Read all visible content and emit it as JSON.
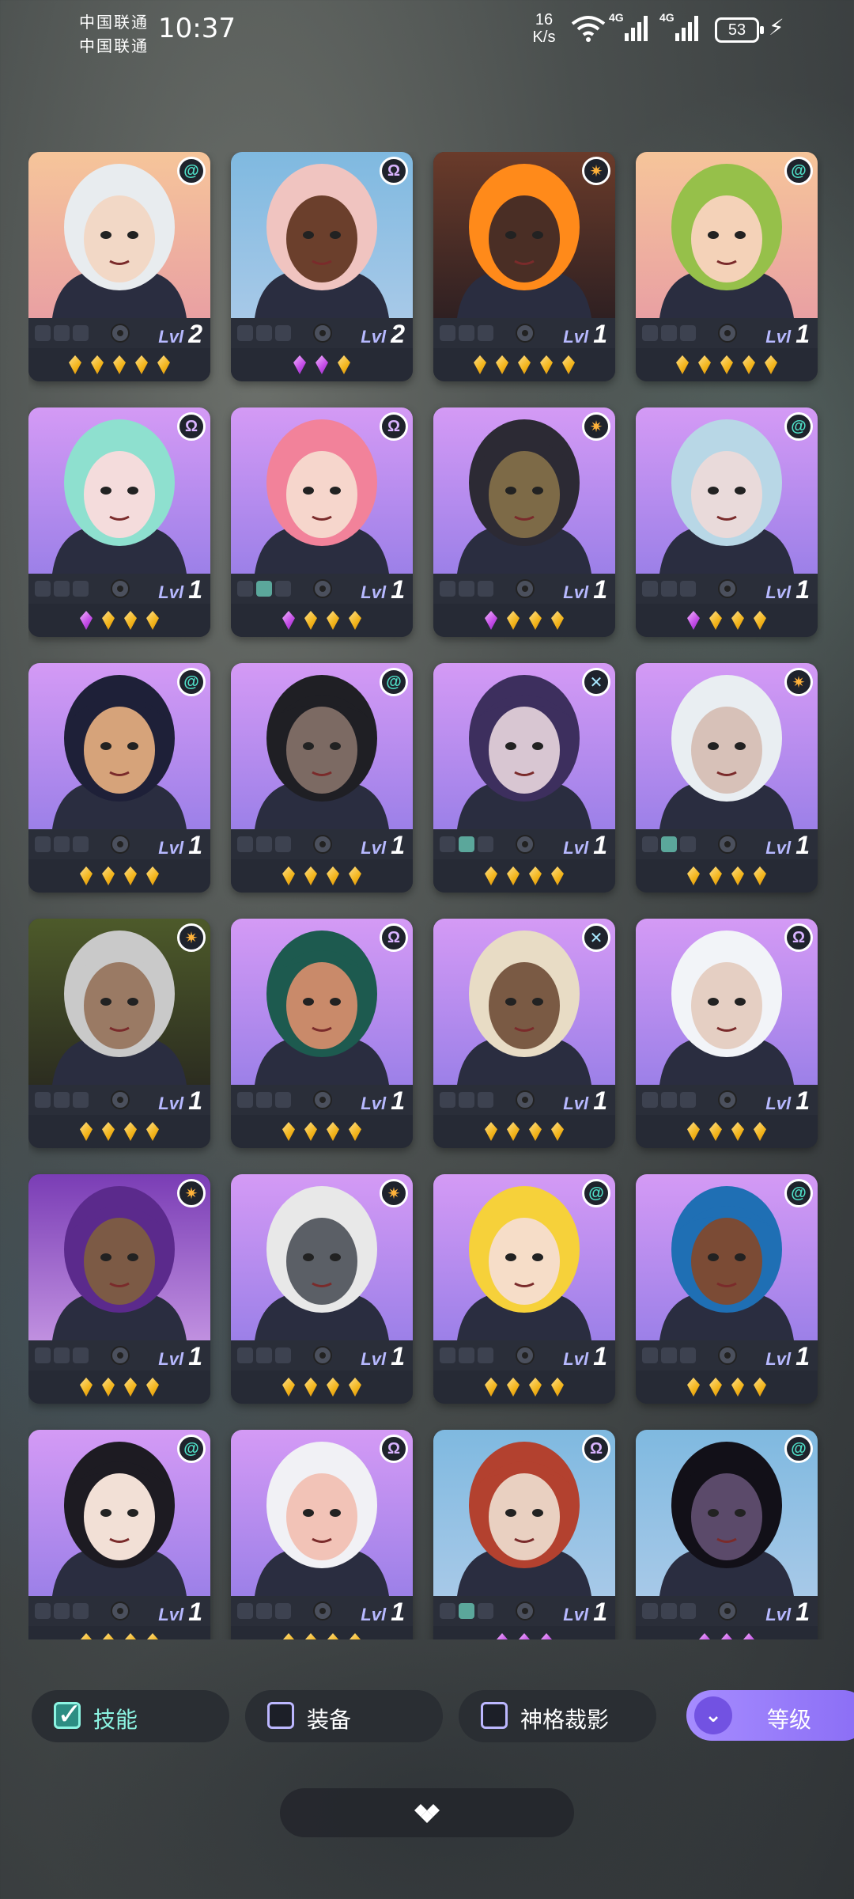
{
  "status_bar": {
    "carrier_1": "中国联通",
    "carrier_2": "中国联通",
    "time": "10:37",
    "net_speed_value": "16",
    "net_speed_unit": "K/s",
    "signal_1": "4G",
    "signal_2": "4G",
    "battery": "53"
  },
  "colors": {
    "portrait_bg_purple": "#c58cf0",
    "portrait_bg_warm": "#f2a56a",
    "accent_teal": "#8cf4e2",
    "accent_purple": "#9c7ff7",
    "gem_gold": "#f2b41b",
    "gem_purple": "#c24be6"
  },
  "class_icons": {
    "spiral": "@",
    "mind": "Ω",
    "sun": "✷",
    "cross": "✕"
  },
  "level_prefix": "Lvl",
  "heroes": [
    {
      "class_icon": "spiral-icon",
      "glyph": "@",
      "level": "2",
      "gems": [
        "gold",
        "gold",
        "gold",
        "gold",
        "gold"
      ],
      "slots_on": [],
      "bg": "warm",
      "hair": "#e8ecef",
      "skin": "#f2d8c6"
    },
    {
      "class_icon": "mind-icon",
      "glyph": "Ω",
      "level": "2",
      "gems": [
        "purple",
        "purple",
        "gold"
      ],
      "slots_on": [],
      "bg": "sky",
      "hair": "#f0c4c0",
      "skin": "#6b3f2c"
    },
    {
      "class_icon": "sun-icon",
      "glyph": "✷",
      "level": "1",
      "gems": [
        "gold",
        "gold",
        "gold",
        "gold",
        "gold"
      ],
      "slots_on": [],
      "bg": "fire",
      "hair": "#ff8a1a",
      "skin": "#4a2e25"
    },
    {
      "class_icon": "spiral-icon",
      "glyph": "@",
      "level": "1",
      "gems": [
        "gold",
        "gold",
        "gold",
        "gold",
        "gold"
      ],
      "slots_on": [],
      "bg": "warm",
      "hair": "#96c04a",
      "skin": "#f4d2b8"
    },
    {
      "class_icon": "mind-icon",
      "glyph": "Ω",
      "level": "1",
      "gems": [
        "purple",
        "gold",
        "gold",
        "gold"
      ],
      "slots_on": [],
      "bg": "purple",
      "hair": "#8ee0cf",
      "skin": "#f4dcdc"
    },
    {
      "class_icon": "mind-icon",
      "glyph": "Ω",
      "level": "1",
      "gems": [
        "purple",
        "gold",
        "gold",
        "gold"
      ],
      "slots_on": [
        1
      ],
      "bg": "purple",
      "hair": "#f2829a",
      "skin": "#f6d6cc"
    },
    {
      "class_icon": "sun-icon",
      "glyph": "✷",
      "level": "1",
      "gems": [
        "purple",
        "gold",
        "gold",
        "gold"
      ],
      "slots_on": [],
      "bg": "purple",
      "hair": "#2c2a34",
      "skin": "#7d6a47"
    },
    {
      "class_icon": "spiral-icon",
      "glyph": "@",
      "level": "1",
      "gems": [
        "purple",
        "gold",
        "gold",
        "gold"
      ],
      "slots_on": [],
      "bg": "purple",
      "hair": "#b8d7e6",
      "skin": "#e9dada"
    },
    {
      "class_icon": "spiral-icon",
      "glyph": "@",
      "level": "1",
      "gems": [
        "gold",
        "gold",
        "gold",
        "gold"
      ],
      "slots_on": [],
      "bg": "purple",
      "hair": "#1e2038",
      "skin": "#d6a37a"
    },
    {
      "class_icon": "spiral-icon",
      "glyph": "@",
      "level": "1",
      "gems": [
        "gold",
        "gold",
        "gold",
        "gold"
      ],
      "slots_on": [],
      "bg": "purple",
      "hair": "#1f1f24",
      "skin": "#7c6a63"
    },
    {
      "class_icon": "cross-icon",
      "glyph": "✕",
      "level": "1",
      "gems": [
        "gold",
        "gold",
        "gold",
        "gold"
      ],
      "slots_on": [
        1
      ],
      "bg": "purple",
      "hair": "#3d2f5e",
      "skin": "#d8c6d2"
    },
    {
      "class_icon": "sun-icon",
      "glyph": "✷",
      "level": "1",
      "gems": [
        "gold",
        "gold",
        "gold",
        "gold"
      ],
      "slots_on": [
        1
      ],
      "bg": "purple",
      "hair": "#e9eef2",
      "skin": "#d7c1b8"
    },
    {
      "class_icon": "sun-icon",
      "glyph": "✷",
      "level": "1",
      "gems": [
        "gold",
        "gold",
        "gold",
        "gold"
      ],
      "slots_on": [],
      "bg": "olive",
      "hair": "#c9c9c9",
      "skin": "#9a7a64"
    },
    {
      "class_icon": "mind-icon",
      "glyph": "Ω",
      "level": "1",
      "gems": [
        "gold",
        "gold",
        "gold",
        "gold"
      ],
      "slots_on": [],
      "bg": "purple",
      "hair": "#1d5a4f",
      "skin": "#c98a6a"
    },
    {
      "class_icon": "cross-icon",
      "glyph": "✕",
      "level": "1",
      "gems": [
        "gold",
        "gold",
        "gold",
        "gold"
      ],
      "slots_on": [],
      "bg": "purple",
      "hair": "#e8dcc5",
      "skin": "#7a5a44"
    },
    {
      "class_icon": "mind-icon",
      "glyph": "Ω",
      "level": "1",
      "gems": [
        "gold",
        "gold",
        "gold",
        "gold"
      ],
      "slots_on": [],
      "bg": "purple",
      "hair": "#f2f4f8",
      "skin": "#e5cfc3"
    },
    {
      "class_icon": "sun-icon",
      "glyph": "✷",
      "level": "1",
      "gems": [
        "gold",
        "gold",
        "gold",
        "gold"
      ],
      "slots_on": [],
      "bg": "violet",
      "hair": "#5b2a8c",
      "skin": "#7c5a45"
    },
    {
      "class_icon": "sun-icon",
      "glyph": "✷",
      "level": "1",
      "gems": [
        "gold",
        "gold",
        "gold",
        "gold"
      ],
      "slots_on": [],
      "bg": "purple",
      "hair": "#e8e8e8",
      "skin": "#5b5f66"
    },
    {
      "class_icon": "spiral-icon",
      "glyph": "@",
      "level": "1",
      "gems": [
        "gold",
        "gold",
        "gold",
        "gold"
      ],
      "slots_on": [],
      "bg": "purple",
      "hair": "#f6d13a",
      "skin": "#f6ddc8"
    },
    {
      "class_icon": "spiral-icon",
      "glyph": "@",
      "level": "1",
      "gems": [
        "gold",
        "gold",
        "gold",
        "gold"
      ],
      "slots_on": [],
      "bg": "purple",
      "hair": "#1f6fb4",
      "skin": "#7b4b35"
    },
    {
      "class_icon": "spiral-icon",
      "glyph": "@",
      "level": "1",
      "gems": [
        "gold",
        "gold",
        "gold",
        "gold"
      ],
      "slots_on": [],
      "bg": "purple",
      "hair": "#1d1b22",
      "skin": "#f2e0d6"
    },
    {
      "class_icon": "mind-icon",
      "glyph": "Ω",
      "level": "1",
      "gems": [
        "gold",
        "gold",
        "gold",
        "gold"
      ],
      "slots_on": [],
      "bg": "purple",
      "hair": "#f1f1f5",
      "skin": "#f2c3b7"
    },
    {
      "class_icon": "mind-icon",
      "glyph": "Ω",
      "level": "1",
      "gems": [
        "purple",
        "purple",
        "purple"
      ],
      "slots_on": [
        1
      ],
      "bg": "sky",
      "hair": "#b3412f",
      "skin": "#e9d0c1"
    },
    {
      "class_icon": "spiral-icon",
      "glyph": "@",
      "level": "1",
      "gems": [
        "purple",
        "purple",
        "purple"
      ],
      "slots_on": [],
      "bg": "sky",
      "hair": "#121018",
      "skin": "#5b4a6a"
    }
  ],
  "filters": [
    {
      "label": "技能",
      "checked": true
    },
    {
      "label": "装备",
      "checked": false
    },
    {
      "label": "神格裁影",
      "checked": false
    }
  ],
  "sort_button": {
    "label": "等级"
  }
}
